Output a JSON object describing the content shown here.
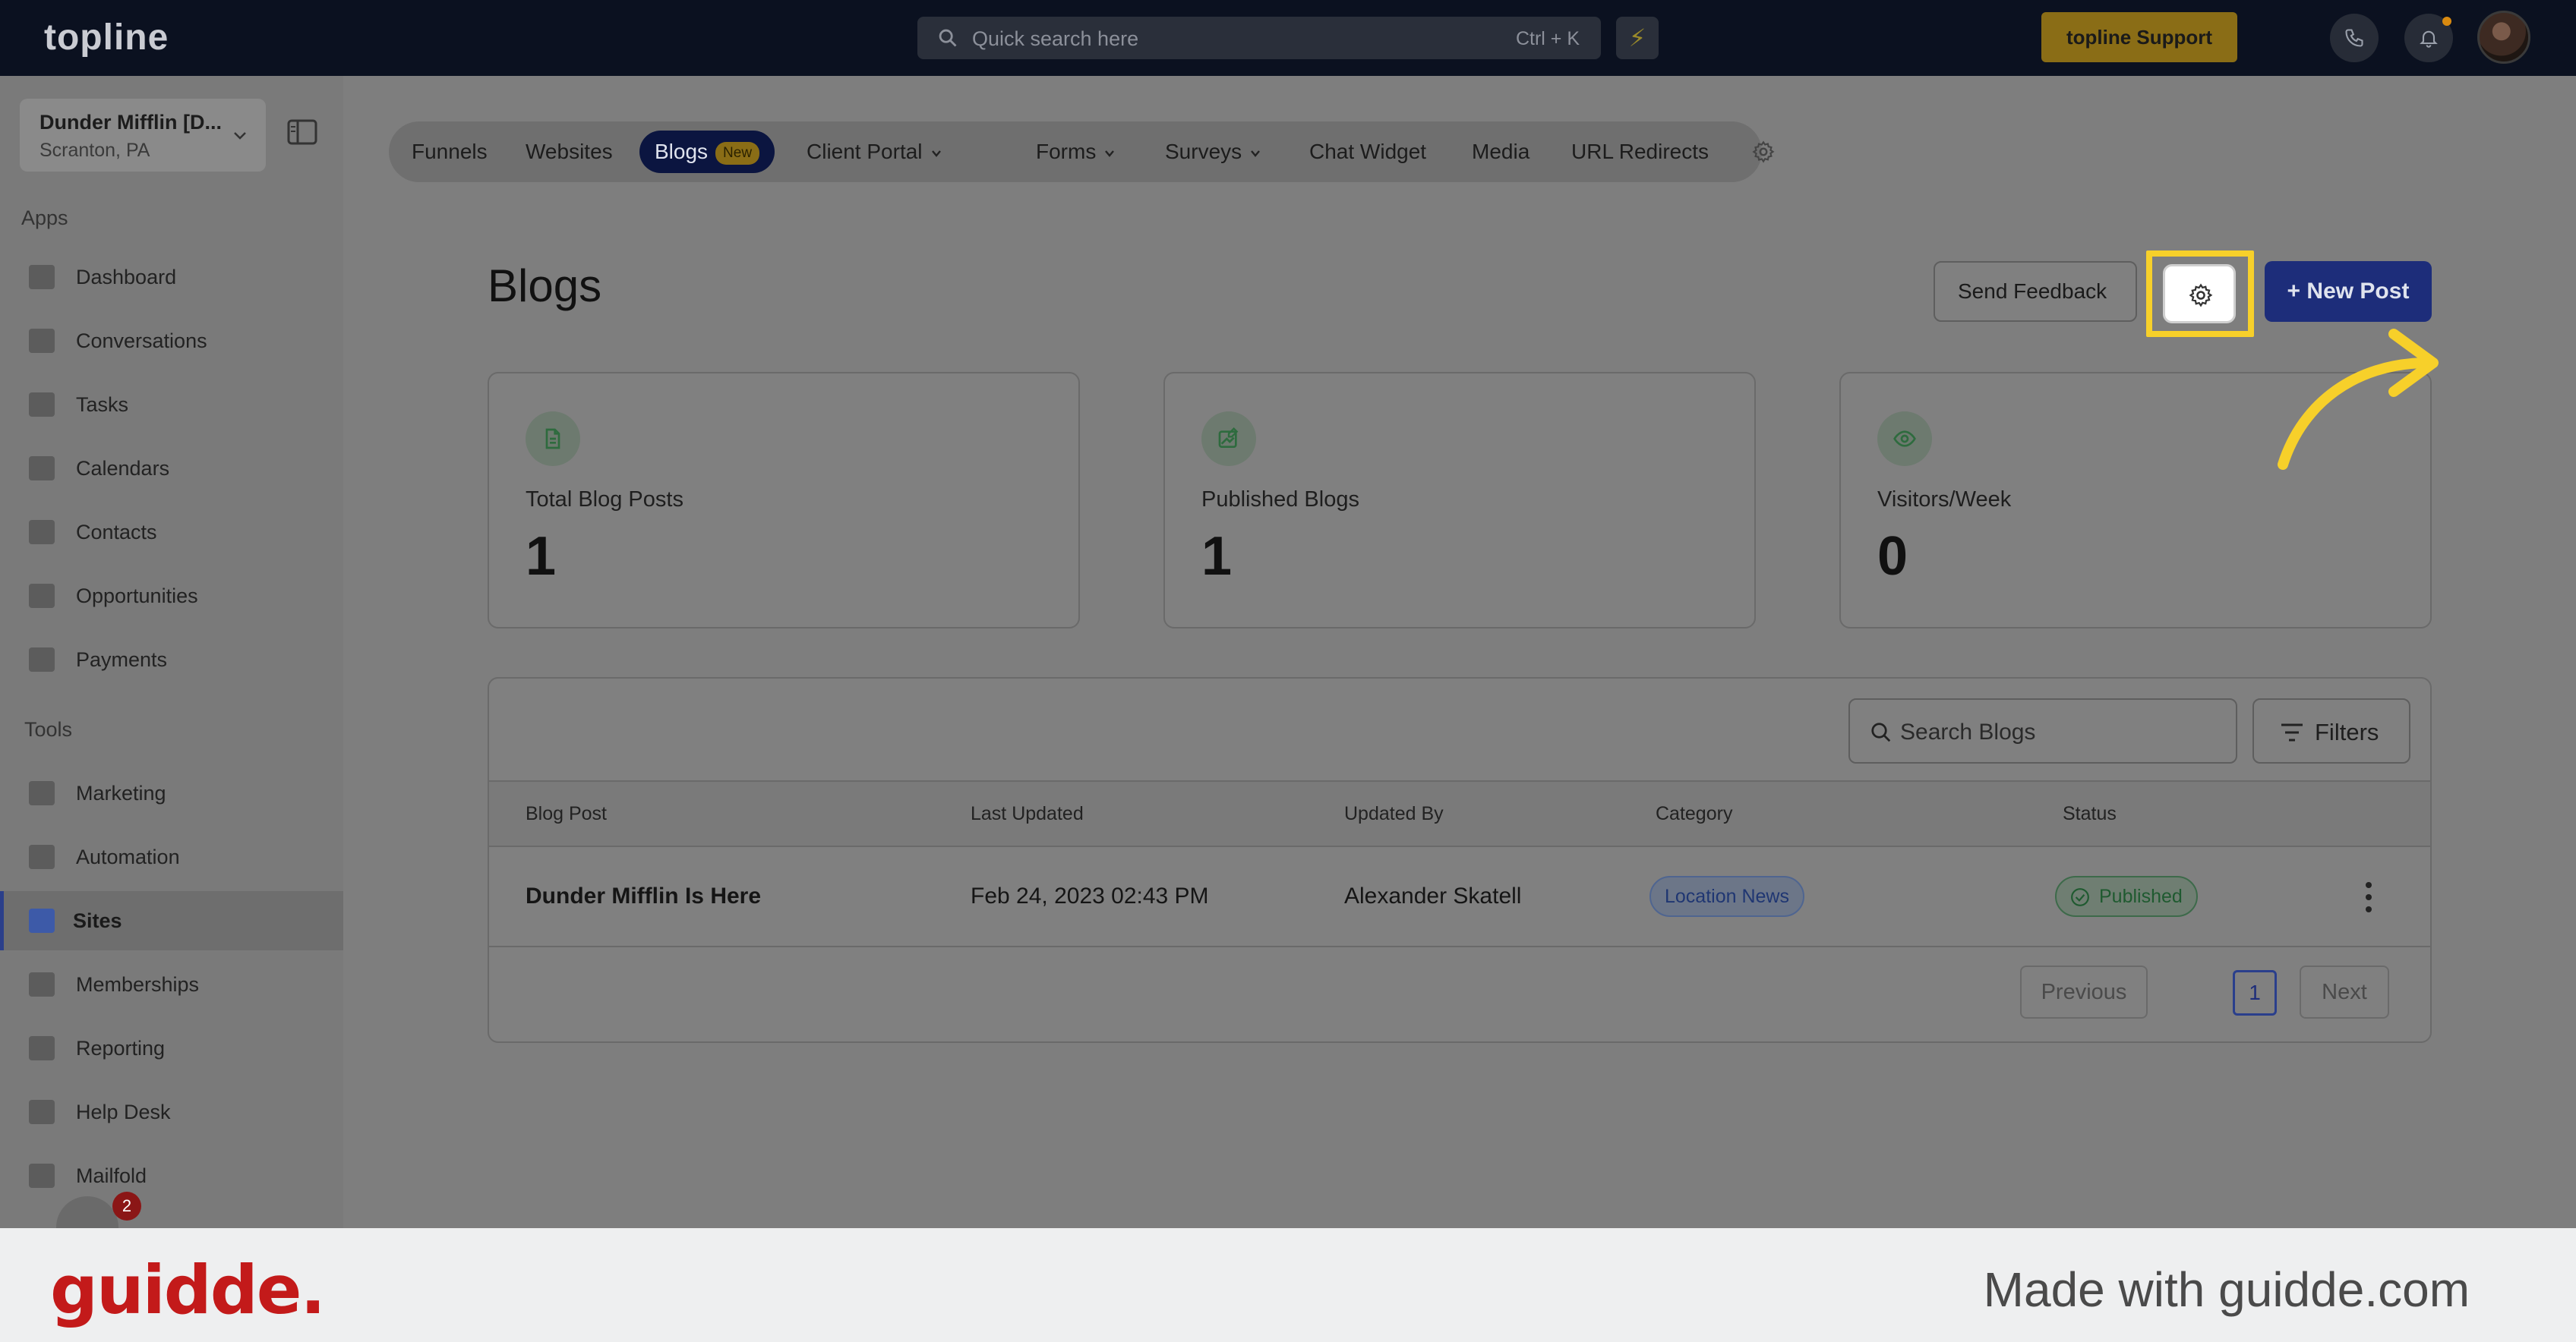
{
  "topbar": {
    "logo": "topline",
    "search_placeholder": "Quick search here",
    "search_shortcut": "Ctrl + K",
    "support_label": "topline Support"
  },
  "sidebar": {
    "account_name": "Dunder Mifflin [D...",
    "account_location": "Scranton, PA",
    "apps_heading": "Apps",
    "apps": [
      {
        "label": "Dashboard",
        "icon": "dashboard-icon"
      },
      {
        "label": "Conversations",
        "icon": "chat-icon"
      },
      {
        "label": "Tasks",
        "icon": "tasks-icon"
      },
      {
        "label": "Calendars",
        "icon": "calendar-icon"
      },
      {
        "label": "Contacts",
        "icon": "contact-icon"
      },
      {
        "label": "Opportunities",
        "icon": "target-icon"
      },
      {
        "label": "Payments",
        "icon": "card-icon"
      }
    ],
    "tools_heading": "Tools",
    "tools": [
      {
        "label": "Marketing",
        "icon": "megaphone-icon"
      },
      {
        "label": "Automation",
        "icon": "gears-icon"
      },
      {
        "label": "Sites",
        "icon": "globe-icon",
        "active": true
      },
      {
        "label": "Memberships",
        "icon": "members-icon"
      },
      {
        "label": "Reporting",
        "icon": "pie-icon"
      },
      {
        "label": "Help Desk",
        "icon": "help-icon"
      },
      {
        "label": "Mailfold",
        "icon": "mail-icon"
      }
    ],
    "chat_badge_count": "2"
  },
  "tabs": [
    {
      "label": "Funnels"
    },
    {
      "label": "Websites"
    },
    {
      "label": "Blogs",
      "badge": "New",
      "active": true
    },
    {
      "label": "Client Portal",
      "dropdown": true
    },
    {
      "label": "Forms",
      "dropdown": true
    },
    {
      "label": "Surveys",
      "dropdown": true
    },
    {
      "label": "Chat Widget"
    },
    {
      "label": "Media"
    },
    {
      "label": "URL Redirects"
    }
  ],
  "page": {
    "title": "Blogs",
    "feedback_label": "Send Feedback",
    "new_post_label": "+ New Post"
  },
  "stats": [
    {
      "label": "Total Blog Posts",
      "value": "1",
      "icon": "document-icon"
    },
    {
      "label": "Published Blogs",
      "value": "1",
      "icon": "image-edit-icon"
    },
    {
      "label": "Visitors/Week",
      "value": "0",
      "icon": "eye-icon"
    }
  ],
  "table": {
    "search_placeholder": "Search Blogs",
    "filters_label": "Filters",
    "columns": [
      "Blog Post",
      "Last Updated",
      "Updated By",
      "Category",
      "Status"
    ],
    "rows": [
      {
        "post": "Dunder Mifflin Is Here",
        "updated": "Feb 24, 2023 02:43 PM",
        "by": "Alexander Skatell",
        "category": "Location News",
        "status": "Published"
      }
    ],
    "pager": {
      "previous": "Previous",
      "current": "1",
      "next": "Next"
    }
  },
  "footer": {
    "brand": "guidde.",
    "made_with": "Made with guidde.com"
  },
  "colors": {
    "highlight": "#f7d02a",
    "primary": "#1d2d7a",
    "brand_red": "#c31a1a"
  }
}
